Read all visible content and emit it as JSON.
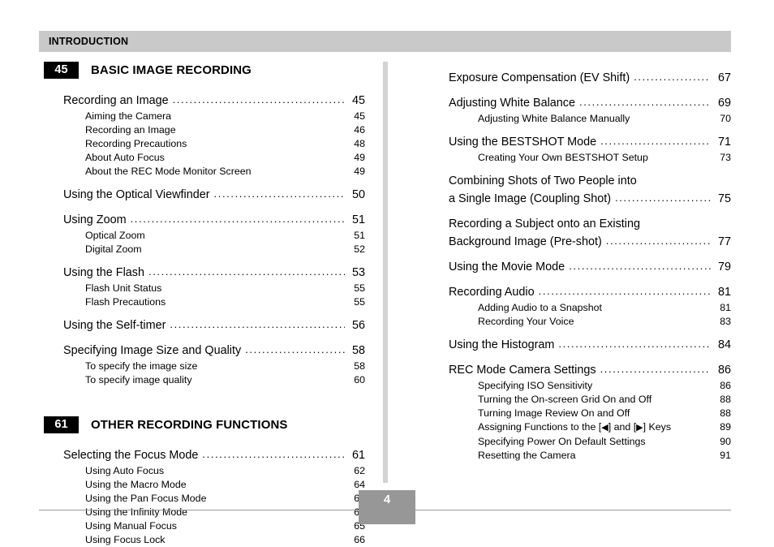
{
  "header": {
    "title": "INTRODUCTION"
  },
  "footer": {
    "page_number": "4"
  },
  "left_column": {
    "sections": [
      {
        "badge": "45",
        "title": "BASIC IMAGE RECORDING",
        "entries": [
          {
            "label": "Recording an Image",
            "page": "45",
            "subentries": [
              {
                "label": "Aiming the Camera",
                "page": "45"
              },
              {
                "label": "Recording an Image",
                "page": "46"
              },
              {
                "label": "Recording Precautions",
                "page": "48"
              },
              {
                "label": "About Auto Focus",
                "page": "49"
              },
              {
                "label": "About the REC Mode Monitor Screen",
                "page": "49"
              }
            ]
          },
          {
            "label": "Using the Optical Viewfinder",
            "page": "50",
            "subentries": []
          },
          {
            "label": "Using Zoom",
            "page": "51",
            "subentries": [
              {
                "label": "Optical Zoom",
                "page": "51"
              },
              {
                "label": "Digital Zoom",
                "page": "52"
              }
            ]
          },
          {
            "label": "Using the Flash",
            "page": "53",
            "subentries": [
              {
                "label": "Flash Unit Status",
                "page": "55"
              },
              {
                "label": "Flash Precautions",
                "page": "55"
              }
            ]
          },
          {
            "label": "Using the Self-timer",
            "page": "56",
            "subentries": []
          },
          {
            "label": "Specifying Image Size and Quality",
            "page": "58",
            "subentries": [
              {
                "label": "To specify the image size",
                "page": "58"
              },
              {
                "label": "To specify image quality",
                "page": "60"
              }
            ]
          }
        ]
      },
      {
        "badge": "61",
        "title": "OTHER RECORDING FUNCTIONS",
        "entries": [
          {
            "label": "Selecting the Focus Mode",
            "page": "61",
            "subentries": [
              {
                "label": "Using Auto Focus",
                "page": "62"
              },
              {
                "label": "Using the Macro Mode",
                "page": "64"
              },
              {
                "label": "Using the Pan Focus Mode",
                "page": "64"
              },
              {
                "label": "Using the Infinity Mode",
                "page": "65"
              },
              {
                "label": "Using Manual Focus",
                "page": "65"
              },
              {
                "label": "Using Focus Lock",
                "page": "66"
              }
            ]
          }
        ]
      }
    ]
  },
  "right_column": {
    "entries": [
      {
        "label": "Exposure Compensation (EV Shift)",
        "page": "67",
        "subentries": []
      },
      {
        "label": "Adjusting White Balance",
        "page": "69",
        "subentries": [
          {
            "label": "Adjusting White Balance Manually",
            "page": "70"
          }
        ]
      },
      {
        "label": "Using the BESTSHOT Mode",
        "page": "71",
        "subentries": [
          {
            "label": "Creating Your Own BESTSHOT Setup",
            "page": "73"
          }
        ]
      },
      {
        "label_line1": "Combining Shots of Two People into",
        "label": "a Single Image (Coupling Shot)",
        "page": "75",
        "subentries": []
      },
      {
        "label_line1": "Recording a Subject onto an Existing",
        "label": "Background Image (Pre-shot)",
        "page": "77",
        "subentries": []
      },
      {
        "label": "Using the Movie Mode",
        "page": "79",
        "subentries": []
      },
      {
        "label": "Recording Audio",
        "page": "81",
        "subentries": [
          {
            "label": "Adding Audio to a Snapshot",
            "page": "81"
          },
          {
            "label": "Recording Your Voice",
            "page": "83"
          }
        ]
      },
      {
        "label": "Using the Histogram",
        "page": "84",
        "subentries": []
      },
      {
        "label": "REC Mode Camera Settings",
        "page": "86",
        "subentries": [
          {
            "label": "Specifying ISO Sensitivity",
            "page": "86"
          },
          {
            "label": "Turning the On-screen Grid On and Off",
            "page": "88"
          },
          {
            "label": "Turning Image Review On and Off",
            "page": "88"
          },
          {
            "label": "Assigning Functions to the [◀] and [▶] Keys",
            "page": "89"
          },
          {
            "label": "Specifying Power On Default Settings",
            "page": "90"
          },
          {
            "label": "Resetting the Camera",
            "page": "91"
          }
        ]
      }
    ]
  },
  "leader_char": "."
}
